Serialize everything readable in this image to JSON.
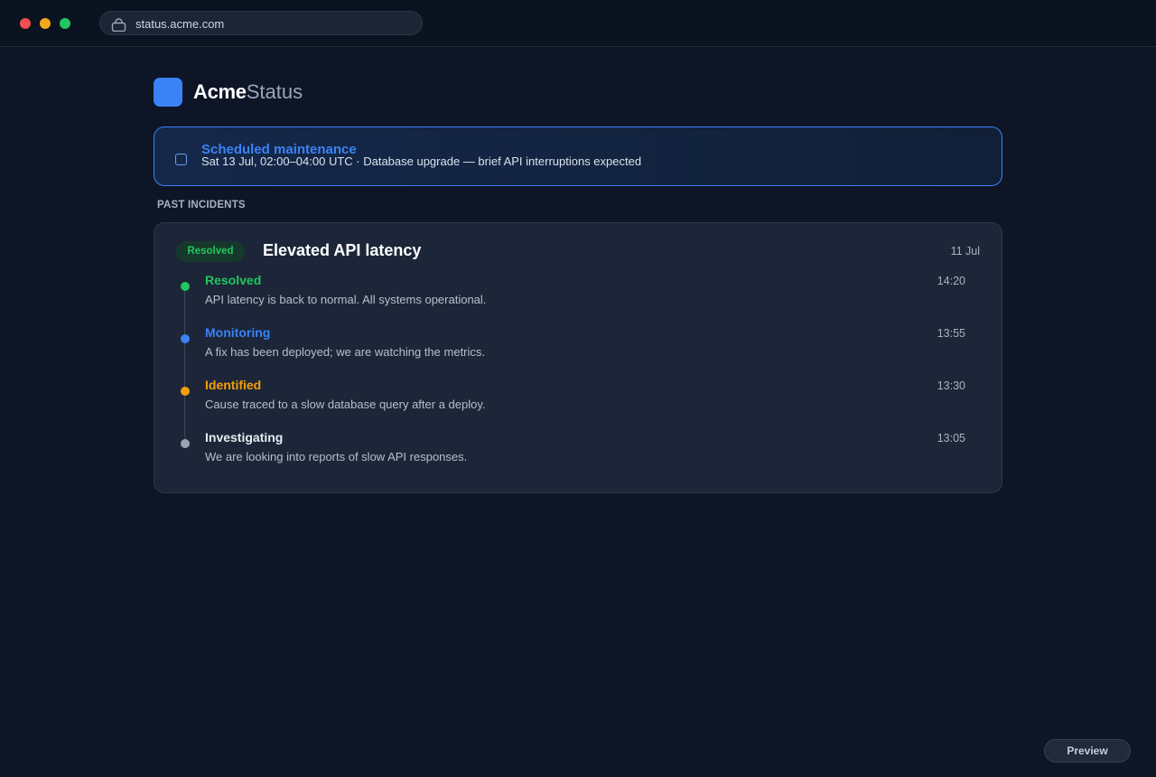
{
  "browser": {
    "url": "status.acme.com"
  },
  "brand": {
    "name_strong": "Acme",
    "name_light": "Status",
    "accent_color": "#3b82f6"
  },
  "maintenance": {
    "title": "Scheduled maintenance",
    "detail": "Sat 13 Jul, 02:00–04:00 UTC · Database upgrade — brief API interruptions expected"
  },
  "past_incidents": {
    "section_label": "PAST INCIDENTS",
    "incident": {
      "status_badge": "Resolved",
      "title": "Elevated API latency",
      "date": "11 Jul",
      "updates": [
        {
          "label": "Resolved",
          "description": "API latency is back to normal. All systems operational.",
          "time": "14:20",
          "color": "#22c55e"
        },
        {
          "label": "Monitoring",
          "description": "A fix has been deployed; we are watching the metrics.",
          "time": "13:55",
          "color": "#3b82f6"
        },
        {
          "label": "Identified",
          "description": "Cause traced to a slow database query after a deploy.",
          "time": "13:30",
          "color": "#f59e0b"
        },
        {
          "label": "Investigating",
          "description": "We are looking into reports of slow API responses.",
          "time": "13:05",
          "color": "#9ca3af"
        }
      ]
    }
  },
  "footer": {
    "preview_label": "Preview"
  }
}
